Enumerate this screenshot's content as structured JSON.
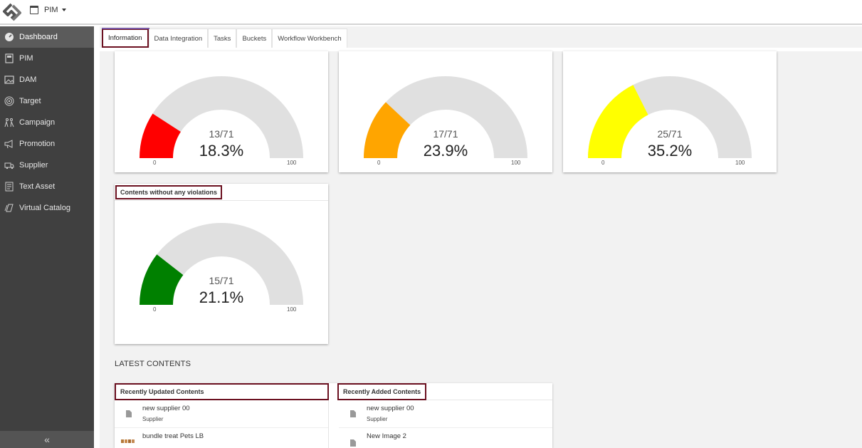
{
  "topbar": {
    "app_label": "PIM"
  },
  "sidebar": {
    "items": [
      {
        "label": "Dashboard",
        "icon": "dashboard-icon",
        "active": true
      },
      {
        "label": "PIM",
        "icon": "pim-icon"
      },
      {
        "label": "DAM",
        "icon": "image-icon"
      },
      {
        "label": "Target",
        "icon": "target-icon"
      },
      {
        "label": "Campaign",
        "icon": "campaign-icon"
      },
      {
        "label": "Promotion",
        "icon": "megaphone-icon"
      },
      {
        "label": "Supplier",
        "icon": "truck-icon"
      },
      {
        "label": "Text Asset",
        "icon": "document-icon"
      },
      {
        "label": "Virtual Catalog",
        "icon": "catalog-icon"
      }
    ],
    "collapse_label": "«"
  },
  "tabs": [
    {
      "label": "Information",
      "active": true
    },
    {
      "label": "Data Integration"
    },
    {
      "label": "Tasks"
    },
    {
      "label": "Buckets"
    },
    {
      "label": "Workflow Workbench"
    }
  ],
  "gauges": [
    {
      "fraction": "13/71",
      "percent": "18.3%",
      "value": 18.3,
      "min": "0",
      "max": "100",
      "color": "#ff0000"
    },
    {
      "fraction": "17/71",
      "percent": "23.9%",
      "value": 23.9,
      "min": "0",
      "max": "100",
      "color": "#ffa500"
    },
    {
      "fraction": "25/71",
      "percent": "35.2%",
      "value": 35.2,
      "min": "0",
      "max": "100",
      "color": "#ffff00"
    },
    {
      "title": "Contents without any violations",
      "fraction": "15/71",
      "percent": "21.1%",
      "value": 21.1,
      "min": "0",
      "max": "100",
      "color": "#008000"
    }
  ],
  "latest": {
    "section_label": "LATEST CONTENTS",
    "updated": {
      "title": "Recently Updated Contents",
      "rows": [
        {
          "title": "new supplier 00",
          "subtitle": "Supplier"
        },
        {
          "title": "bundle treat Pets LB",
          "subtitle": ""
        }
      ]
    },
    "added": {
      "title": "Recently Added Contents",
      "rows": [
        {
          "title": "new supplier 00",
          "subtitle": "Supplier"
        },
        {
          "title": "New Image 2",
          "subtitle": ""
        }
      ]
    }
  },
  "colors": {
    "sidebar_bg": "#404040",
    "highlight_border": "#6b1020",
    "gauge_track": "#e0e0e0"
  }
}
